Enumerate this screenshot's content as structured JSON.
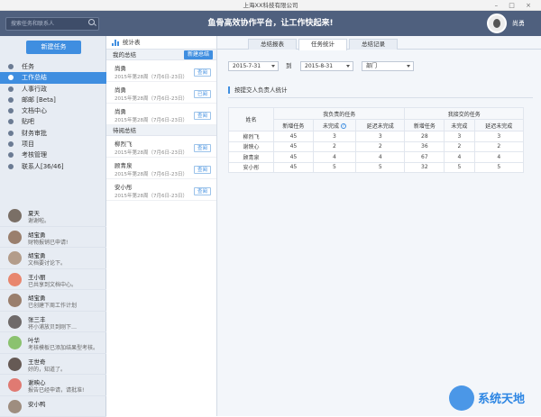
{
  "window": {
    "title": "上海XX科技有限公司",
    "controls": "– □ ×"
  },
  "header": {
    "search_placeholder": "搜索任务和联系人",
    "slogan": "鱼骨高效协作平台，让工作快起来!",
    "username": "尚勇"
  },
  "sidebar": {
    "new_task_button": "新建任务",
    "nav": [
      {
        "label": "任务",
        "icon": "gear-icon"
      },
      {
        "label": "工作总结",
        "icon": "document-icon",
        "active": true
      },
      {
        "label": "人事行政",
        "icon": "pin-icon"
      },
      {
        "label": "邮邮 [Beta]",
        "icon": "mail-icon"
      },
      {
        "label": "文档中心",
        "icon": "folder-icon"
      },
      {
        "label": "贴吧",
        "icon": "chat-icon"
      },
      {
        "label": "财务审批",
        "icon": "money-icon"
      },
      {
        "label": "项目",
        "icon": "grid-icon"
      },
      {
        "label": "考核管理",
        "icon": "check-icon"
      },
      {
        "label": "联系人[36/46]",
        "icon": "users-icon"
      }
    ],
    "contacts": [
      {
        "name": "夏天",
        "message": "谢谢啦。",
        "color": "#7a6f66"
      },
      {
        "name": "胡宝勇",
        "message": "财物报销已申请!",
        "color": "#9a7f6d"
      },
      {
        "name": "胡宝勇",
        "message": "文档要讨论下。",
        "color": "#b39c8a"
      },
      {
        "name": "王小丽",
        "message": "已共享到文档中心。",
        "color": "#e8866e"
      },
      {
        "name": "胡宝勇",
        "message": "已创建下周工作计划",
        "color": "#9a7f6d"
      },
      {
        "name": "张三丰",
        "message": "将小浦放贝到刚下…",
        "color": "#6f6a6a"
      },
      {
        "name": "叶华",
        "message": "考核模板已添加结果型考核。",
        "color": "#8bc26f"
      },
      {
        "name": "王世奇",
        "message": "好的，知道了。",
        "color": "#665a55"
      },
      {
        "name": "谢映心",
        "message": "报告已经申请，请批准!",
        "color": "#e07a72"
      },
      {
        "name": "安小鸭",
        "message": "",
        "color": "#9e8d7f"
      }
    ]
  },
  "middle": {
    "title": "统计表",
    "my_section": "我的总结",
    "new_summary_button": "新建总结",
    "my_entries": [
      {
        "name": "尚勇",
        "date": "2015年第28周（7月6日-23日）",
        "status": "查阅"
      },
      {
        "name": "尚勇",
        "date": "2015年第28周（7月6日-23日）",
        "status": "已阅"
      },
      {
        "name": "尚勇",
        "date": "2015年第28周（7月6日-23日）",
        "status": "查阅"
      }
    ],
    "review_section": "待阅总结",
    "review_entries": [
      {
        "name": "柳烈飞",
        "date": "2015年第28周（7月6日-23日）",
        "status": "查阅"
      },
      {
        "name": "顾青泉",
        "date": "2015年第28周（7月6日-23日）",
        "status": "查阅"
      },
      {
        "name": "安小彤",
        "date": "2015年第28周（7月6日-23日）",
        "status": "查阅"
      }
    ]
  },
  "main": {
    "tabs": [
      {
        "label": "总结报表",
        "active": false
      },
      {
        "label": "任务统计",
        "active": true
      },
      {
        "label": "总结记录",
        "active": false
      }
    ],
    "date_from": "2015-7-31",
    "to_label": "到",
    "date_to": "2015-8-31",
    "department": "部门",
    "stats_title": "按提交人负责人统计",
    "table": {
      "name_header": "姓名",
      "group_responsible": "我负责的任务",
      "group_assigned": "我接交的任务",
      "sub_headers": [
        "新增任务",
        "未完成",
        "延迟未完成",
        "新增任务",
        "未完成",
        "延迟未完成"
      ],
      "rows": [
        {
          "name": "柳烈飞",
          "values": [
            "45",
            "3",
            "3",
            "28",
            "3",
            "3"
          ]
        },
        {
          "name": "谢映心",
          "values": [
            "45",
            "2",
            "2",
            "36",
            "2",
            "2"
          ]
        },
        {
          "name": "顾青泉",
          "values": [
            "45",
            "4",
            "4",
            "67",
            "4",
            "4"
          ]
        },
        {
          "name": "安小彤",
          "values": [
            "45",
            "5",
            "5",
            "32",
            "5",
            "5"
          ]
        }
      ]
    }
  },
  "watermark": {
    "text": "系统天地"
  }
}
